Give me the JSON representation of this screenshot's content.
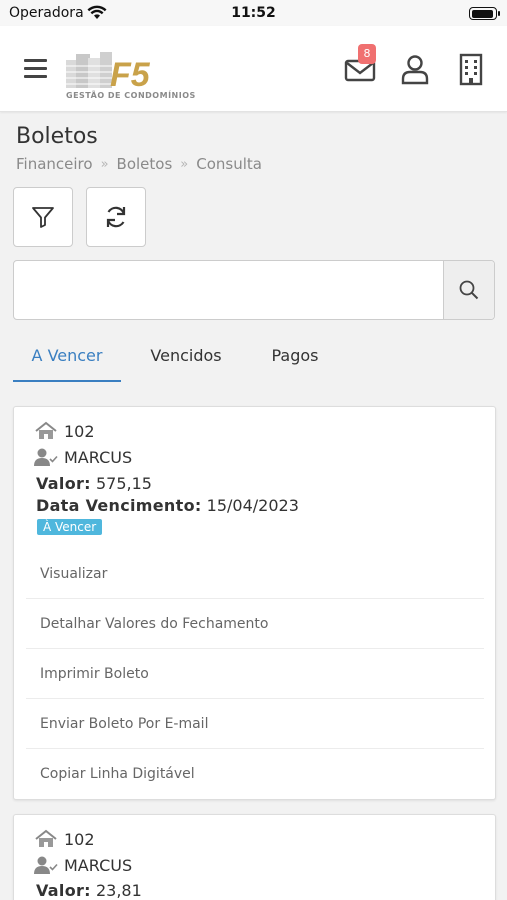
{
  "status_bar": {
    "carrier": "Operadora",
    "time": "11:52"
  },
  "header": {
    "logo_text": "F5",
    "logo_sub": "GESTÃO DE CONDOMÍNIOS",
    "mail_badge": "8",
    "brand_gold": "#c9a24a"
  },
  "page": {
    "title": "Boletos",
    "breadcrumb": [
      "Financeiro",
      "Boletos",
      "Consulta"
    ]
  },
  "search": {
    "value": "",
    "placeholder": ""
  },
  "tabs": [
    {
      "label": "A Vencer",
      "active": true
    },
    {
      "label": "Vencidos",
      "active": false
    },
    {
      "label": "Pagos",
      "active": false
    }
  ],
  "boletos": [
    {
      "unit": "102",
      "name": "MARCUS",
      "valor_label": "Valor:",
      "valor": "575,15",
      "venc_label": "Data Vencimento:",
      "vencimento": "15/04/2023",
      "status": "À Vencer",
      "actions": [
        "Visualizar",
        "Detalhar Valores do Fechamento",
        "Imprimir Boleto",
        "Enviar Boleto Por E-mail",
        "Copiar Linha Digitável"
      ]
    },
    {
      "unit": "102",
      "name": "MARCUS",
      "valor_label": "Valor:",
      "valor": "23,81"
    }
  ],
  "colors": {
    "accent": "#3a7fc1",
    "badge_red": "#f07070",
    "status_blue": "#4fb7dd"
  }
}
